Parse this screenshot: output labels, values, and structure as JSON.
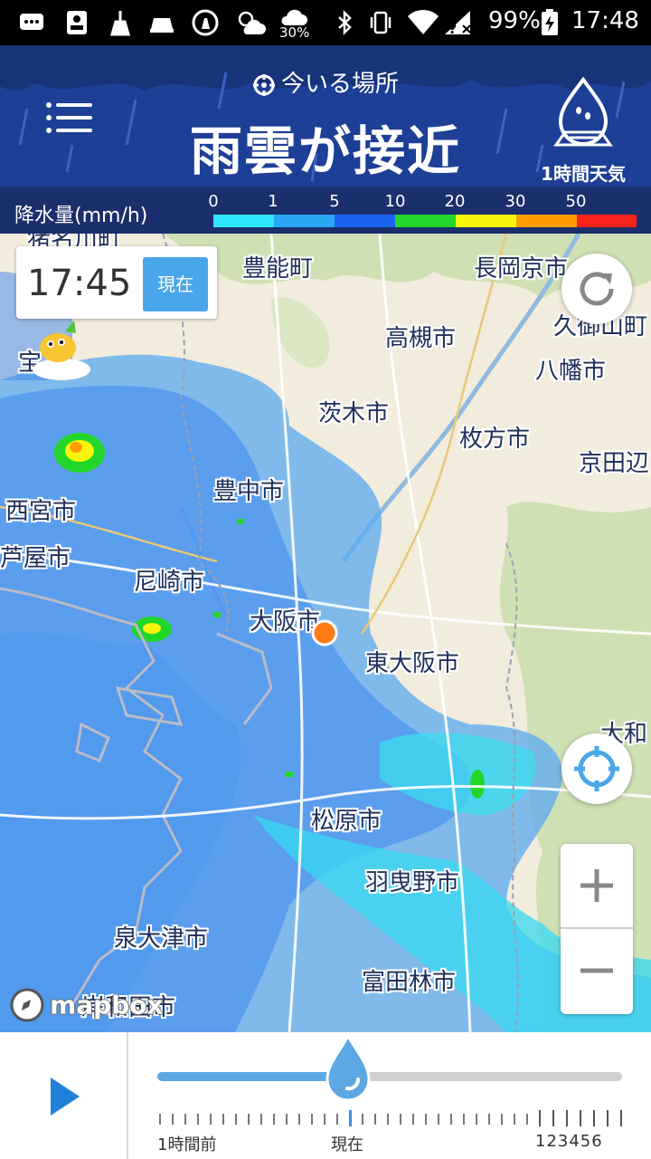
{
  "status_bar": {
    "weather_percent": "30%",
    "battery": "99%",
    "clock": "17:48"
  },
  "header": {
    "location_label": "今いる場所",
    "headline": "雨雲が接近",
    "hourly_label": "1時間天気"
  },
  "legend": {
    "title": "降水量(mm/h)",
    "ticks": [
      "0",
      "1",
      "5",
      "10",
      "20",
      "30",
      "50"
    ],
    "colors": [
      "#2fe6ff",
      "#2aa7f5",
      "#1d63f2",
      "#22d629",
      "#f9f40e",
      "#ff9d00",
      "#f7221a"
    ]
  },
  "map": {
    "time": "17:45",
    "now_button": "現在",
    "attribution": "mapbox",
    "cities": [
      "豊能町",
      "長岡京市",
      "高槻市",
      "久御山町",
      "八幡市",
      "茨木市",
      "枚方市",
      "京田辺",
      "西宮市",
      "豊中市",
      "芦屋市",
      "尼崎市",
      "大阪市",
      "東大阪市",
      "大和",
      "松原市",
      "羽曳野市",
      "泉大津市",
      "富田林市",
      "岸和田市",
      "宝"
    ]
  },
  "timeline": {
    "label_left": "1時間前",
    "label_now": "現在",
    "label_right": "123456",
    "progress": 0.41
  },
  "icons": {
    "menu": "hamburger-menu-icon",
    "location": "location-target-icon",
    "hourly": "rain-drop-umbrella-icon",
    "refresh": "refresh-icon",
    "locate": "crosshair-icon",
    "zoom_in": "plus-icon",
    "zoom_out": "minus-icon",
    "play": "play-icon"
  }
}
